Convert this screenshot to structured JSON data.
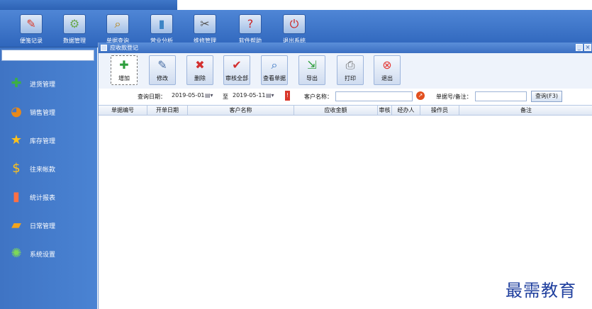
{
  "window": {
    "title": ""
  },
  "toolbar": {
    "items": [
      {
        "label": "便笺记录",
        "icon": "notepad-icon",
        "color": "#d93a2a"
      },
      {
        "label": "数据管理",
        "icon": "data-icon",
        "color": "#6aa84f"
      },
      {
        "label": "单据查询",
        "icon": "search-icon",
        "color": "#f2b01e"
      },
      {
        "label": "营业分析",
        "icon": "chart-icon",
        "color": "#3d85c6"
      },
      {
        "label": "维修管理",
        "icon": "tools-icon",
        "color": "#666666"
      },
      {
        "label": "软件帮助",
        "icon": "help-icon",
        "color": "#cc2222"
      },
      {
        "label": "退出系统",
        "icon": "power-icon",
        "color": "#cc2222"
      }
    ]
  },
  "sidebar": {
    "items": [
      {
        "label": "进货管理",
        "icon": "plus-icon"
      },
      {
        "label": "销售管理",
        "icon": "pie-icon"
      },
      {
        "label": "库存管理",
        "icon": "star-icon"
      },
      {
        "label": "往来帐款",
        "icon": "dollar-icon"
      },
      {
        "label": "统计报表",
        "icon": "bar-chart-icon"
      },
      {
        "label": "日常管理",
        "icon": "folder-icon"
      },
      {
        "label": "系统设置",
        "icon": "gear-icon"
      }
    ]
  },
  "doc": {
    "title": "应收款登记",
    "actions": [
      "增加",
      "修改",
      "删除",
      "审核全部",
      "查看单据",
      "导出",
      "打印",
      "退出"
    ],
    "query": {
      "date_label": "查询日期：",
      "date_from": "2019-05-01",
      "to_label": "至",
      "date_to": "2019-05-11",
      "customer_label": "客户名称：",
      "customer_value": "",
      "memo_label": "单据号/备注：",
      "memo_value": "",
      "search_button": "查询(F3)"
    },
    "columns": [
      "单据编号",
      "开单日期",
      "客户名称",
      "应收金额",
      "审核",
      "经办人",
      "操作员",
      "备注"
    ]
  },
  "watermark": "最需教育"
}
